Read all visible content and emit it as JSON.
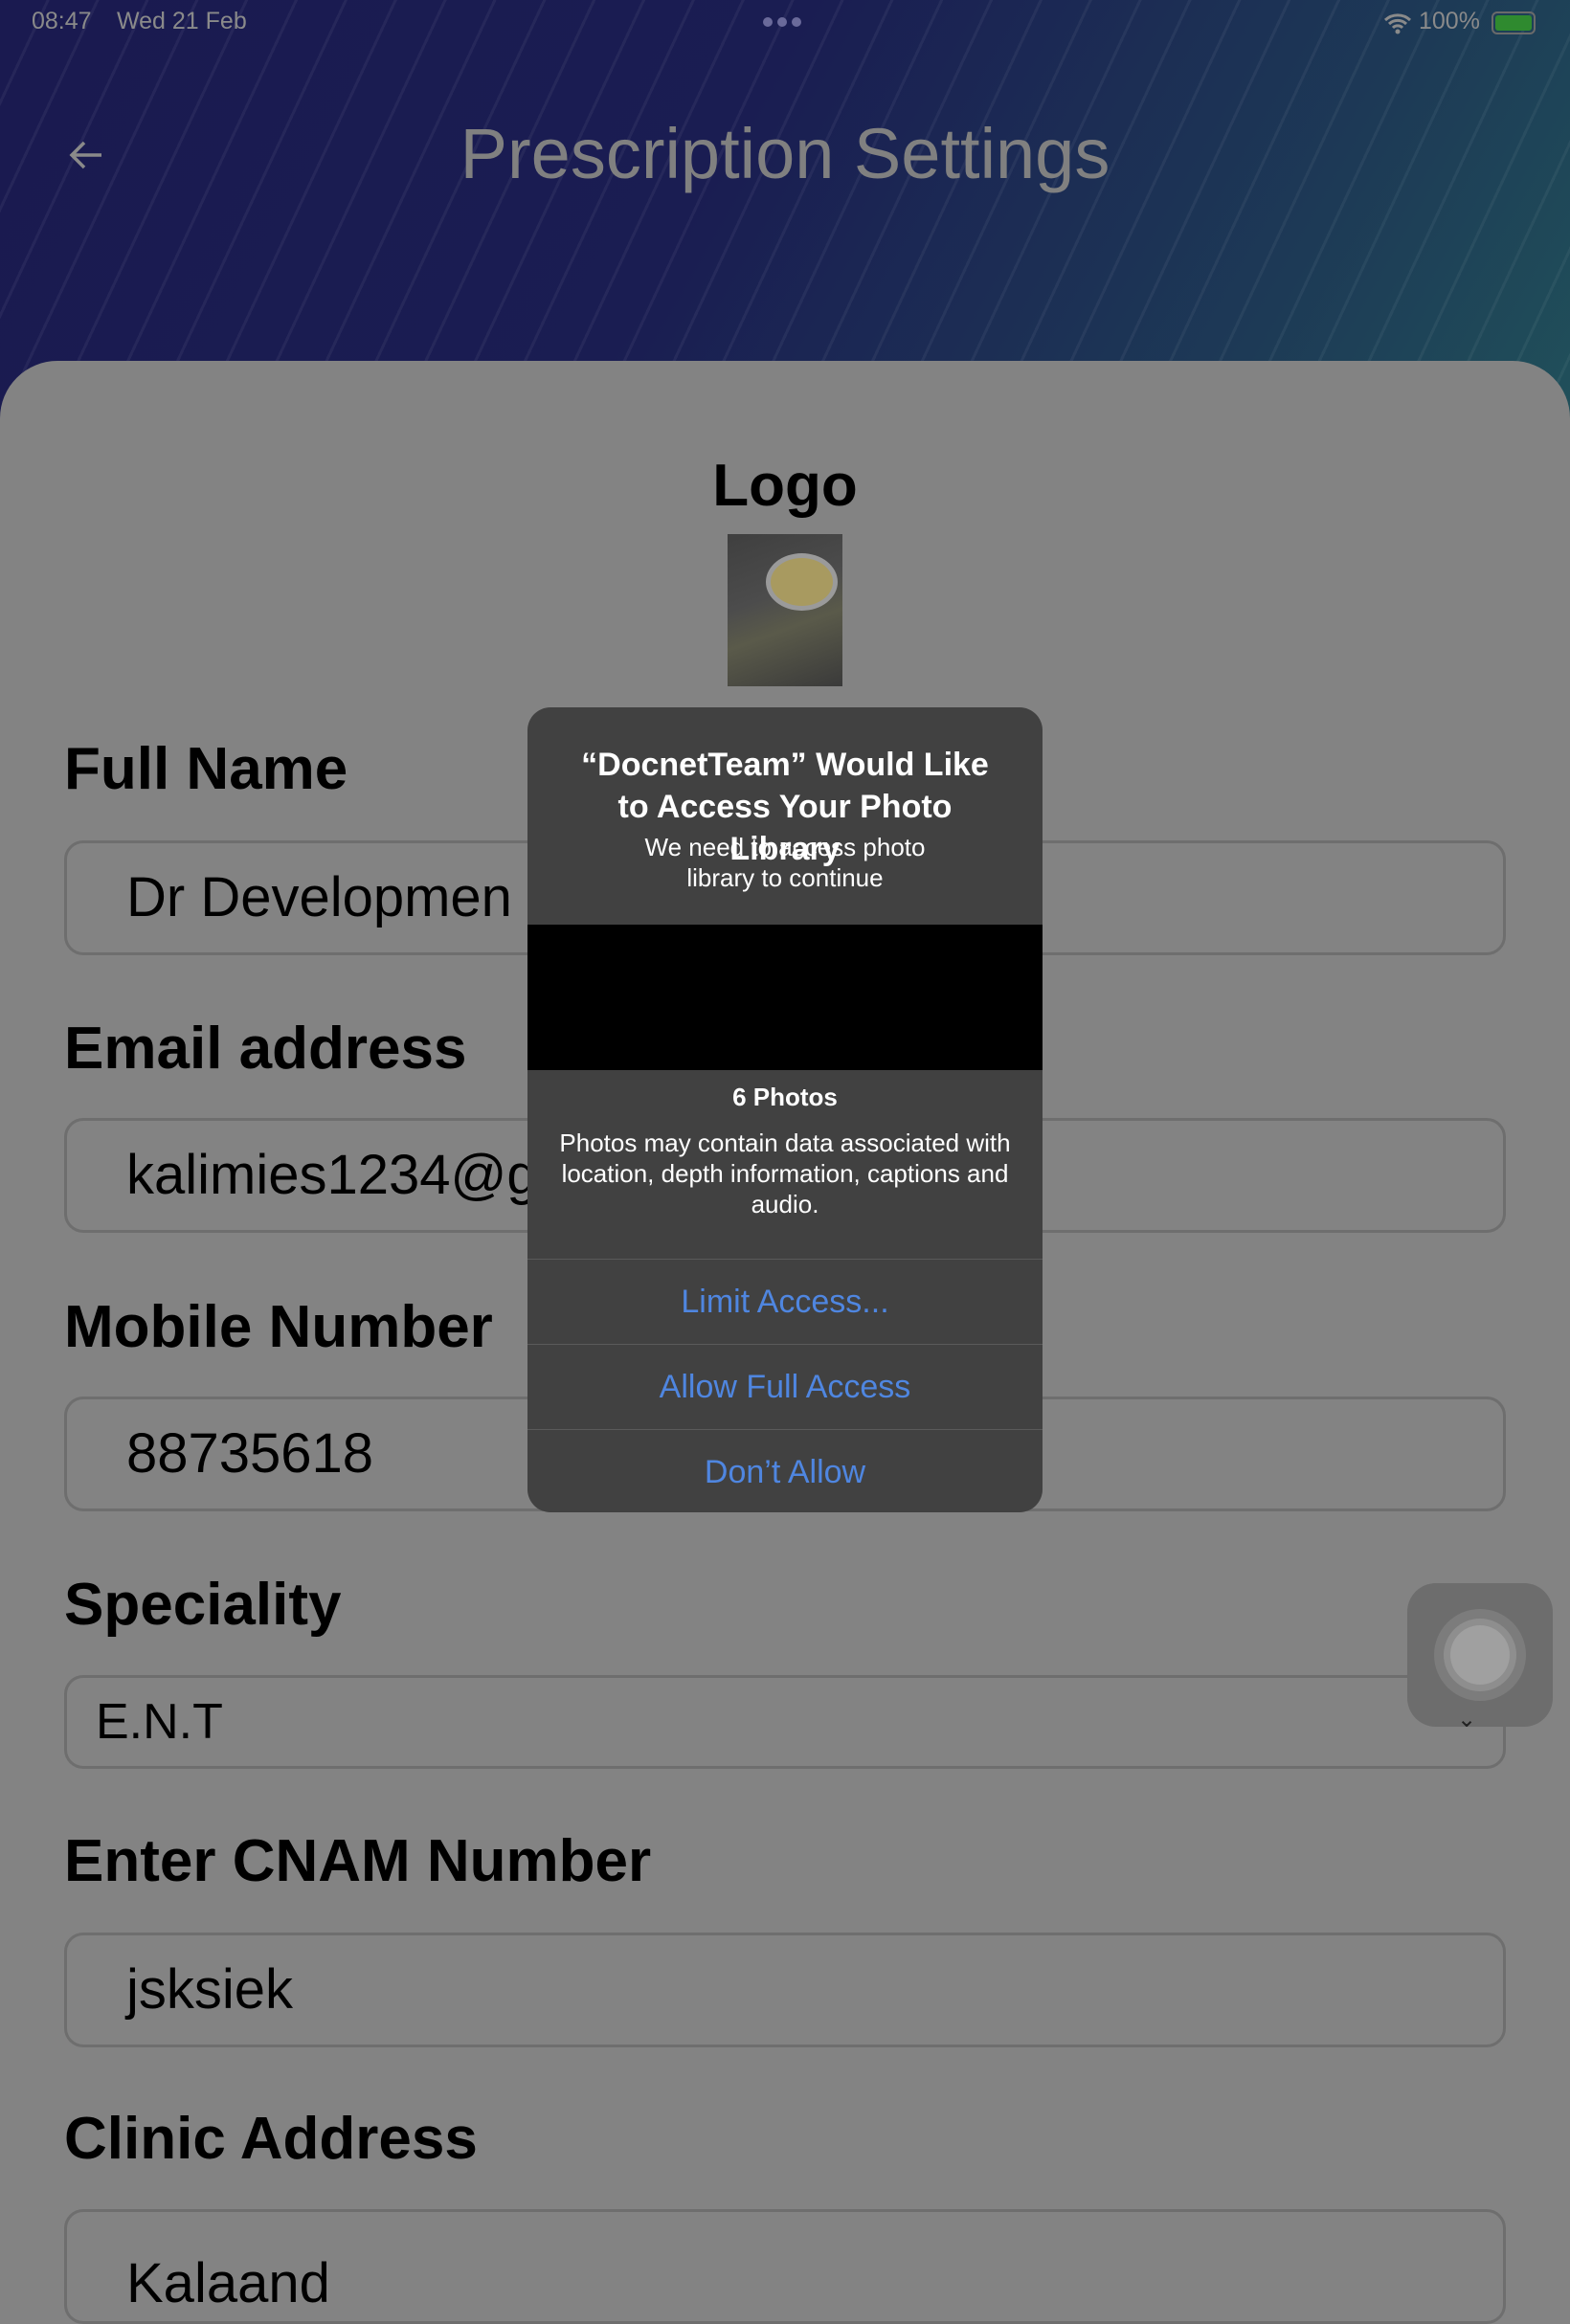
{
  "status_bar": {
    "time": "08:47",
    "date": "Wed 21 Feb",
    "battery": "100%"
  },
  "header": {
    "title": "Prescription Settings"
  },
  "form": {
    "logo_label": "Logo",
    "full_name_label": "Full Name",
    "full_name_value": "Dr Developmen",
    "email_label": "Email address",
    "email_value": "kalimies1234@g",
    "mobile_label": "Mobile Number",
    "mobile_value": "88735618",
    "speciality_label": "Speciality",
    "speciality_value": "E.N.T",
    "cnam_label": "Enter CNAM Number",
    "cnam_value": "jsksiek",
    "clinic_label": "Clinic Address",
    "clinic_value": "Kalaand"
  },
  "dialog": {
    "title": "“DocnetTeam” Would Like to Access Your Photo Library",
    "message": "We need to access photo library to continue",
    "photo_count": "6 Photos",
    "info": "Photos may contain data associated with location, depth information, captions and audio.",
    "buttons": [
      "Limit Access...",
      "Allow Full Access",
      "Don’t Allow"
    ]
  }
}
